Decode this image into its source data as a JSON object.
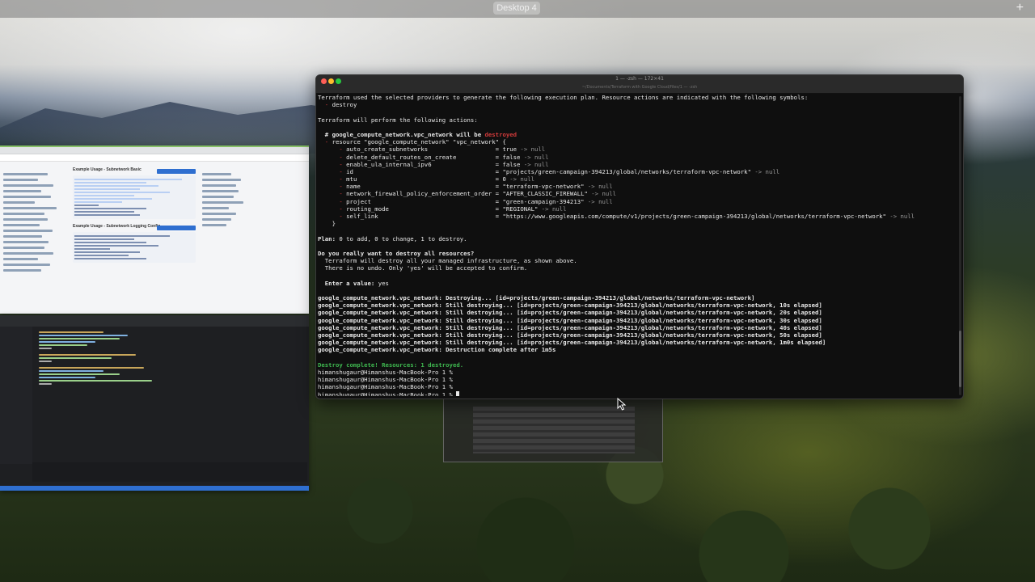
{
  "desktop": {
    "space_label": "Desktop 4",
    "add_space_glyph": "+"
  },
  "terminal": {
    "title": "1 — -zsh — 172×41",
    "subtitle": "~/Documents/Terraform with Google Cloud/files/1 — -zsh",
    "lines": [
      {
        "segments": [
          {
            "t": "Terraform used the selected providers to generate the following execution plan. Resource actions are indicated with the following symbols:"
          }
        ]
      },
      {
        "segments": [
          {
            "t": "  "
          },
          {
            "t": "- ",
            "c": "red"
          },
          {
            "t": "destroy"
          }
        ]
      },
      {
        "segments": [
          {
            "t": ""
          }
        ]
      },
      {
        "segments": [
          {
            "t": "Terraform will perform the following actions:"
          }
        ]
      },
      {
        "segments": [
          {
            "t": ""
          }
        ]
      },
      {
        "segments": [
          {
            "t": "  # google_compute_network.vpc_network",
            "b": true
          },
          {
            "t": " will be ",
            "b": true
          },
          {
            "t": "destroyed",
            "c": "red",
            "b": true
          }
        ]
      },
      {
        "segments": [
          {
            "t": "  "
          },
          {
            "t": "- ",
            "c": "red"
          },
          {
            "t": "resource \"google_compute_network\" \"vpc_network\" {"
          }
        ]
      },
      {
        "segments": [
          {
            "t": "      "
          },
          {
            "t": "- ",
            "c": "red"
          },
          {
            "t": "auto_create_subnetworks                   = true "
          },
          {
            "t": "-> null",
            "c": "dim"
          }
        ]
      },
      {
        "segments": [
          {
            "t": "      "
          },
          {
            "t": "- ",
            "c": "red"
          },
          {
            "t": "delete_default_routes_on_create           = false "
          },
          {
            "t": "-> null",
            "c": "dim"
          }
        ]
      },
      {
        "segments": [
          {
            "t": "      "
          },
          {
            "t": "- ",
            "c": "red"
          },
          {
            "t": "enable_ula_internal_ipv6                  = false "
          },
          {
            "t": "-> null",
            "c": "dim"
          }
        ]
      },
      {
        "segments": [
          {
            "t": "      "
          },
          {
            "t": "- ",
            "c": "red"
          },
          {
            "t": "id                                        = \"projects/green-campaign-394213/global/networks/terraform-vpc-network\" "
          },
          {
            "t": "-> null",
            "c": "dim"
          }
        ]
      },
      {
        "segments": [
          {
            "t": "      "
          },
          {
            "t": "- ",
            "c": "red"
          },
          {
            "t": "mtu                                       = 0 "
          },
          {
            "t": "-> null",
            "c": "dim"
          }
        ]
      },
      {
        "segments": [
          {
            "t": "      "
          },
          {
            "t": "- ",
            "c": "red"
          },
          {
            "t": "name                                      = \"terraform-vpc-network\" "
          },
          {
            "t": "-> null",
            "c": "dim"
          }
        ]
      },
      {
        "segments": [
          {
            "t": "      "
          },
          {
            "t": "- ",
            "c": "red"
          },
          {
            "t": "network_firewall_policy_enforcement_order = \"AFTER_CLASSIC_FIREWALL\" "
          },
          {
            "t": "-> null",
            "c": "dim"
          }
        ]
      },
      {
        "segments": [
          {
            "t": "      "
          },
          {
            "t": "- ",
            "c": "red"
          },
          {
            "t": "project                                   = \"green-campaign-394213\" "
          },
          {
            "t": "-> null",
            "c": "dim"
          }
        ]
      },
      {
        "segments": [
          {
            "t": "      "
          },
          {
            "t": "- ",
            "c": "red"
          },
          {
            "t": "routing_mode                              = \"REGIONAL\" "
          },
          {
            "t": "-> null",
            "c": "dim"
          }
        ]
      },
      {
        "segments": [
          {
            "t": "      "
          },
          {
            "t": "- ",
            "c": "red"
          },
          {
            "t": "self_link                                 = \"https://www.googleapis.com/compute/v1/projects/green-campaign-394213/global/networks/terraform-vpc-network\" "
          },
          {
            "t": "-> null",
            "c": "dim"
          }
        ]
      },
      {
        "segments": [
          {
            "t": "    }"
          }
        ]
      },
      {
        "segments": [
          {
            "t": ""
          }
        ]
      },
      {
        "segments": [
          {
            "t": "Plan:",
            "b": true
          },
          {
            "t": " 0 to add, 0 to change, 1 to destroy."
          }
        ]
      },
      {
        "segments": [
          {
            "t": ""
          }
        ]
      },
      {
        "segments": [
          {
            "t": "Do you really want to destroy all resources?",
            "b": true
          }
        ]
      },
      {
        "segments": [
          {
            "t": "  Terraform will destroy all your managed infrastructure, as shown above."
          }
        ]
      },
      {
        "segments": [
          {
            "t": "  There is no undo. Only 'yes' will be accepted to confirm."
          }
        ]
      },
      {
        "segments": [
          {
            "t": ""
          }
        ]
      },
      {
        "segments": [
          {
            "t": "  Enter a value:",
            "b": true
          },
          {
            "t": " yes"
          }
        ]
      },
      {
        "segments": [
          {
            "t": ""
          }
        ]
      },
      {
        "segments": [
          {
            "t": "google_compute_network.vpc_network: Destroying... [id=projects/green-campaign-394213/global/networks/terraform-vpc-network]",
            "b": true
          }
        ]
      },
      {
        "segments": [
          {
            "t": "google_compute_network.vpc_network: Still destroying... [id=projects/green-campaign-394213/global/networks/terraform-vpc-network, 10s elapsed]",
            "b": true
          }
        ]
      },
      {
        "segments": [
          {
            "t": "google_compute_network.vpc_network: Still destroying... [id=projects/green-campaign-394213/global/networks/terraform-vpc-network, 20s elapsed]",
            "b": true
          }
        ]
      },
      {
        "segments": [
          {
            "t": "google_compute_network.vpc_network: Still destroying... [id=projects/green-campaign-394213/global/networks/terraform-vpc-network, 30s elapsed]",
            "b": true
          }
        ]
      },
      {
        "segments": [
          {
            "t": "google_compute_network.vpc_network: Still destroying... [id=projects/green-campaign-394213/global/networks/terraform-vpc-network, 40s elapsed]",
            "b": true
          }
        ]
      },
      {
        "segments": [
          {
            "t": "google_compute_network.vpc_network: Still destroying... [id=projects/green-campaign-394213/global/networks/terraform-vpc-network, 50s elapsed]",
            "b": true
          }
        ]
      },
      {
        "segments": [
          {
            "t": "google_compute_network.vpc_network: Still destroying... [id=projects/green-campaign-394213/global/networks/terraform-vpc-network, 1m0s elapsed]",
            "b": true
          }
        ]
      },
      {
        "segments": [
          {
            "t": "google_compute_network.vpc_network: Destruction complete after 1m5s",
            "b": true
          }
        ]
      },
      {
        "segments": [
          {
            "t": ""
          }
        ]
      },
      {
        "segments": [
          {
            "t": "Destroy complete! Resources: 1 destroyed.",
            "c": "green"
          }
        ]
      },
      {
        "segments": [
          {
            "t": "himanshugaur@Himanshus-MacBook-Pro 1 %"
          }
        ]
      },
      {
        "segments": [
          {
            "t": "himanshugaur@Himanshus-MacBook-Pro 1 %"
          }
        ]
      },
      {
        "segments": [
          {
            "t": "himanshugaur@Himanshus-MacBook-Pro 1 %"
          }
        ]
      },
      {
        "segments": [
          {
            "t": "himanshugaur@Himanshus-MacBook-Pro 1 % "
          }
        ],
        "cursor": true
      }
    ]
  },
  "browser": {
    "doc_headings": [
      "Example Usage - Subnetwork Basic",
      "Example Usage - Subnetwork Logging Config"
    ]
  },
  "colors": {
    "terminal_bg": "#0f0f0f",
    "destroy_red": "#d43b3b",
    "success_green": "#3fb950",
    "editor_accent": "#2f6fd0"
  }
}
